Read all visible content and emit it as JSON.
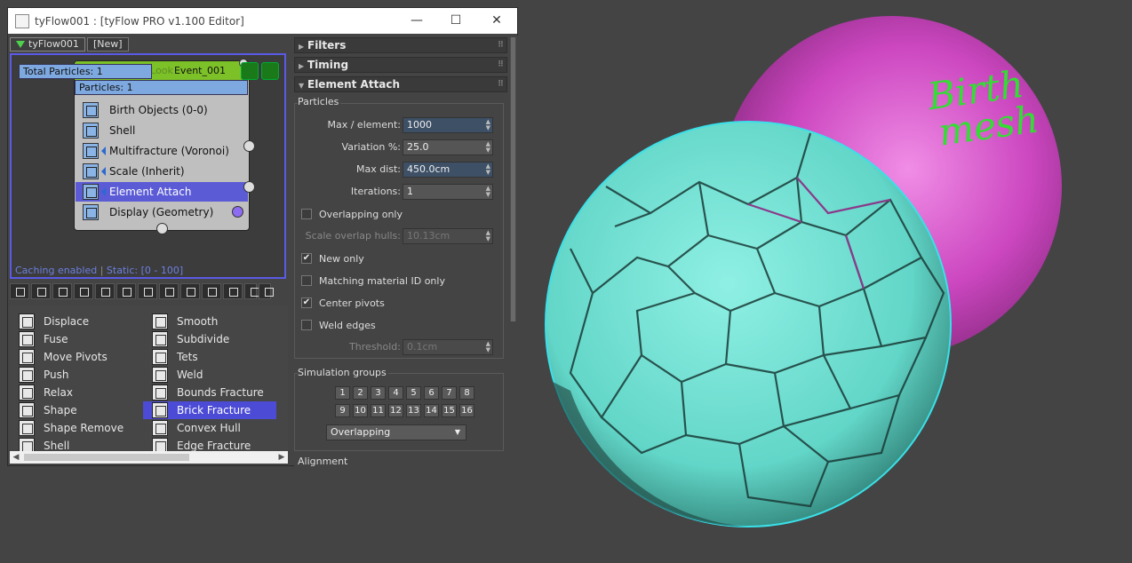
{
  "window": {
    "title": "tyFlow001 : [tyFlow PRO v1.100 Editor]",
    "minimize": "—",
    "maximize": "☐",
    "close": "✕"
  },
  "flow_tabs": [
    {
      "label": "tyFlow001",
      "active": true
    },
    {
      "label": "[New]",
      "active": false
    }
  ],
  "event": {
    "name": "Event_001",
    "ghost_text": "Bake Quick Look",
    "total_particles": "Total Particles: 1",
    "particles": "Particles: 1",
    "operators": [
      {
        "label": "Birth Objects (0-0)",
        "icon": "birth-objects-icon",
        "selected": false
      },
      {
        "label": "Shell",
        "icon": "shell-icon",
        "selected": false
      },
      {
        "label": "Multifracture (Voronoi)",
        "icon": "multifracture-icon",
        "selected": false
      },
      {
        "label": "Scale (Inherit)",
        "icon": "scale-icon",
        "selected": false
      },
      {
        "label": "Element Attach",
        "icon": "element-attach-icon",
        "selected": true
      },
      {
        "label": "Display (Geometry)",
        "icon": "display-icon",
        "selected": false
      }
    ]
  },
  "cache_status": {
    "left": "Caching enabled",
    "sep": " | ",
    "right": "Static: [0 - 100]"
  },
  "operator_list": {
    "col1": [
      "Displace",
      "Fuse",
      "Move Pivots",
      "Push",
      "Relax",
      "Shape",
      "Shape Remove",
      "Shell"
    ],
    "col2": [
      "Smooth",
      "Subdivide",
      "Tets",
      "Weld",
      "Bounds Fracture",
      "Brick Fracture",
      "Convex Hull",
      "Edge Fracture"
    ],
    "selected": "Brick Fracture"
  },
  "rollouts": {
    "filters": "Filters",
    "timing": "Timing",
    "element_attach": "Element Attach"
  },
  "element_attach": {
    "group_particles": "Particles",
    "params": [
      {
        "label": "Max / element:",
        "value": "1000",
        "highlight": true,
        "disabled": false
      },
      {
        "label": "Variation %:",
        "value": "25.0",
        "highlight": false,
        "disabled": false
      },
      {
        "label": "Max dist:",
        "value": "450.0cm",
        "highlight": true,
        "disabled": false
      },
      {
        "label": "Iterations:",
        "value": "1",
        "highlight": false,
        "disabled": false
      }
    ],
    "overlapping_only": {
      "label": "Overlapping only",
      "checked": false
    },
    "scale_overlap": {
      "label": "Scale overlap hulls:",
      "value": "10.13cm",
      "disabled": true
    },
    "new_only": {
      "label": "New only",
      "checked": true
    },
    "matching_material": {
      "label": "Matching material ID only",
      "checked": false
    },
    "center_pivots": {
      "label": "Center pivots",
      "checked": true
    },
    "weld_edges": {
      "label": "Weld edges",
      "checked": false
    },
    "threshold": {
      "label": "Threshold:",
      "value": "0.1cm",
      "disabled": true
    },
    "check_mark": "✔",
    "group_sim": "Simulation groups",
    "groups": [
      "1",
      "2",
      "3",
      "4",
      "5",
      "6",
      "7",
      "8",
      "9",
      "10",
      "11",
      "12",
      "13",
      "14",
      "15",
      "16"
    ],
    "sim_mode": "Overlapping",
    "alignment": "Alignment"
  },
  "viewport": {
    "annotation_line1": "Birth",
    "annotation_line2": "mesh",
    "colors": {
      "birth_sphere": "#c23fb8",
      "fractured_sphere": "#6ee0d2",
      "background": "#444444",
      "annotation": "#33dd33"
    }
  }
}
